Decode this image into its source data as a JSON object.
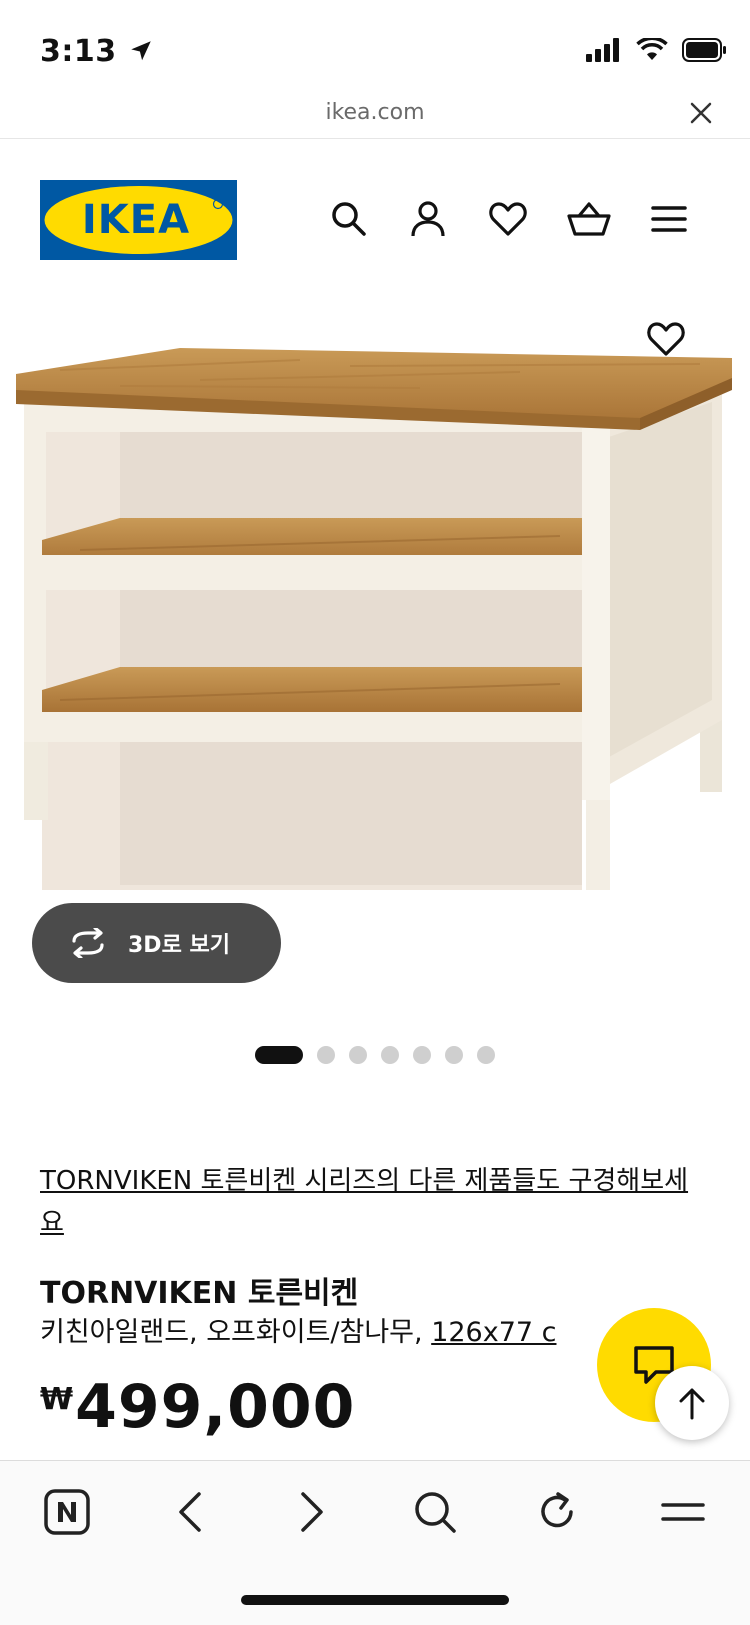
{
  "status_bar": {
    "time": "3:13"
  },
  "browser": {
    "url": "ikea.com"
  },
  "brand": {
    "logo_text": "IKEA",
    "logo_blue": "#0058a3",
    "logo_yellow": "#ffdb00"
  },
  "header": {
    "icons": [
      "search-icon",
      "account-icon",
      "wishlist-icon",
      "cart-icon",
      "menu-icon"
    ]
  },
  "product": {
    "view_3d_label": "3D로 보기",
    "carousel": {
      "count": 7,
      "active_index": 0
    },
    "series_link": "TORNVIKEN 토른비켄 시리즈의 다른 제품들도 구경해보세요",
    "name": "TORNVIKEN 토른비켄",
    "description_prefix": "키친아일랜드, 오프화이트/참나무, ",
    "size_link": "126x77 c",
    "currency": "₩",
    "price": "499,000"
  },
  "colors": {
    "chat_button": "#ffdb00",
    "pill": "#4b4b4b"
  }
}
